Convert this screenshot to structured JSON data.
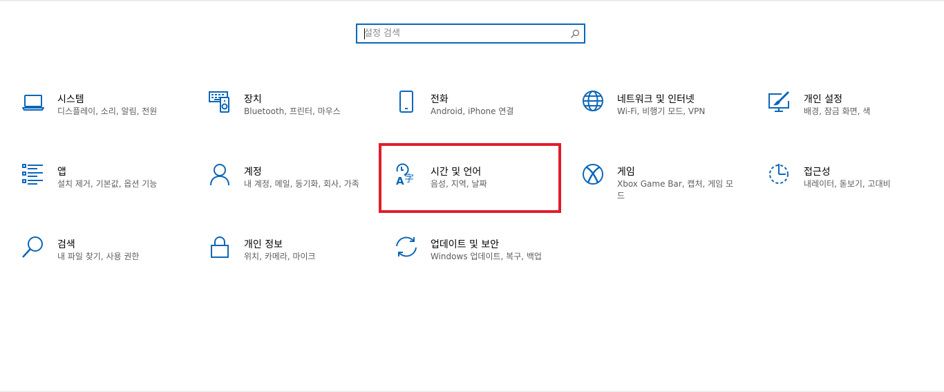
{
  "search": {
    "placeholder": "설정 검색",
    "icon": "search-icon"
  },
  "tiles": [
    {
      "id": "system",
      "title": "시스템",
      "desc": "디스플레이, 소리, 알림, 전원",
      "icon": "laptop-icon"
    },
    {
      "id": "devices",
      "title": "장치",
      "desc": "Bluetooth, 프린터, 마우스",
      "icon": "devices-icon"
    },
    {
      "id": "phone",
      "title": "전화",
      "desc": "Android, iPhone 연결",
      "icon": "phone-icon"
    },
    {
      "id": "network",
      "title": "네트워크 및 인터넷",
      "desc": "Wi-Fi, 비행기 모드, VPN",
      "icon": "globe-icon"
    },
    {
      "id": "personalization",
      "title": "개인 설정",
      "desc": "배경, 잠금 화면, 색",
      "icon": "personalization-icon"
    },
    {
      "id": "apps",
      "title": "앱",
      "desc": "설치 제거, 기본값, 옵션 기능",
      "icon": "apps-list-icon"
    },
    {
      "id": "accounts",
      "title": "계정",
      "desc": "내 계정, 메일, 동기화, 회사, 가족",
      "icon": "person-icon"
    },
    {
      "id": "time-language",
      "title": "시간 및 언어",
      "desc": "음성, 지역, 날짜",
      "icon": "time-language-icon"
    },
    {
      "id": "gaming",
      "title": "게임",
      "desc": "Xbox Game Bar, 캡처, 게임 모드",
      "icon": "xbox-icon"
    },
    {
      "id": "accessibility",
      "title": "접근성",
      "desc": "내레이터, 돋보기, 고대비",
      "icon": "accessibility-icon"
    },
    {
      "id": "search",
      "title": "검색",
      "desc": "내 파일 찾기, 사용 권한",
      "icon": "magnifier-icon"
    },
    {
      "id": "privacy",
      "title": "개인 정보",
      "desc": "위치, 카메라, 마이크",
      "icon": "lock-icon"
    },
    {
      "id": "update-security",
      "title": "업데이트 및 보안",
      "desc": "Windows 업데이트, 복구, 백업",
      "icon": "sync-icon"
    }
  ],
  "colors": {
    "accent": "#0a66b8",
    "highlight": "#e11d2a",
    "description": "#5c5c5c"
  }
}
